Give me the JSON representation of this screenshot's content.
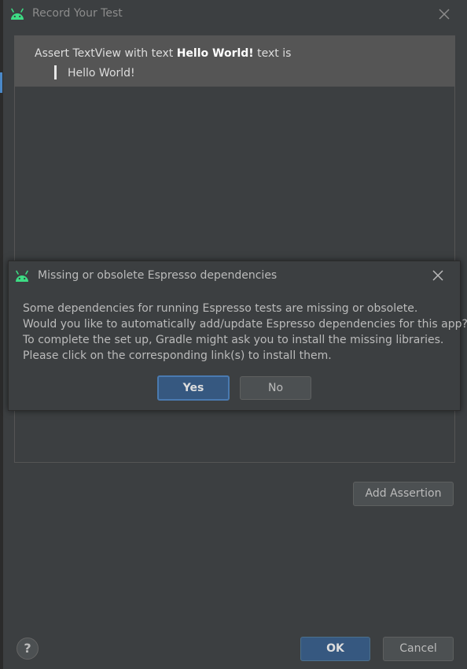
{
  "dialog": {
    "title": "Record Your Test",
    "title_icon": "android-icon",
    "close_icon": "close-icon"
  },
  "assertion": {
    "prefix": "Assert TextView with text ",
    "target": "Hello World!",
    "suffix": " text is",
    "value": "Hello World!"
  },
  "buttons": {
    "add_assertion": "Add Assertion",
    "help": "?",
    "ok": "OK",
    "cancel": "Cancel"
  },
  "modal": {
    "title": "Missing or obsolete Espresso dependencies",
    "title_icon": "android-icon",
    "close_icon": "close-icon",
    "message": [
      "Some dependencies for running Espresso tests are missing or obsolete.",
      "Would you like to automatically add/update Espresso dependencies for this app?",
      "To complete the set up, Gradle might ask you to install the missing libraries.",
      "Please click on the corresponding link(s) to install them."
    ],
    "yes_label": "Yes",
    "no_label": "No"
  },
  "colors": {
    "background": "#3c3f41",
    "selected_row": "#555555",
    "primary_button": "#365880",
    "android_green": "#3ddc84"
  }
}
